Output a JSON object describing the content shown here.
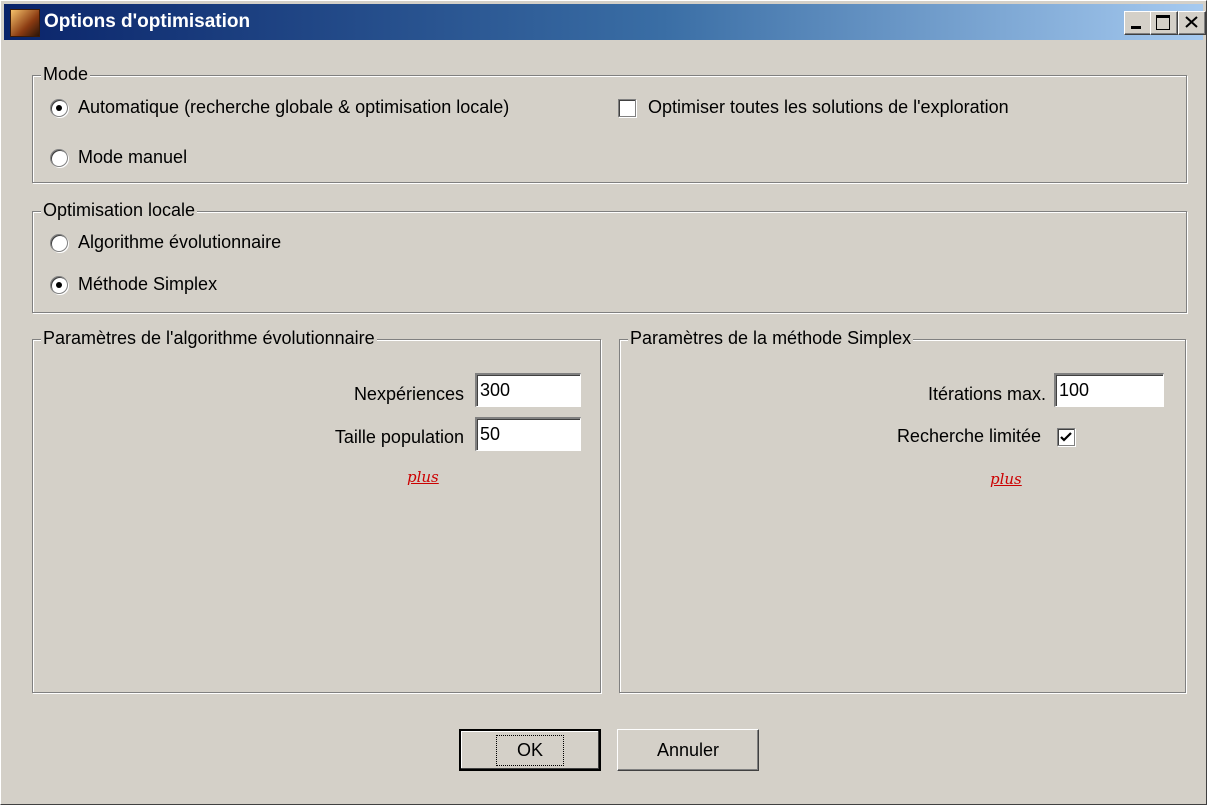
{
  "window": {
    "title": "Options d'optimisation"
  },
  "mode": {
    "legend": "Mode",
    "automatic_label": "Automatique (recherche globale & optimisation locale)",
    "automatic_selected": true,
    "manual_label": "Mode manuel",
    "manual_selected": false,
    "optimize_all_label": "Optimiser toutes les solutions de l'exploration",
    "optimize_all_checked": false
  },
  "local_optimisation": {
    "legend": "Optimisation locale",
    "evolutionary_label": "Algorithme évolutionnaire",
    "evolutionary_selected": false,
    "simplex_label": "Méthode Simplex",
    "simplex_selected": true
  },
  "evolutionary_params": {
    "legend": "Paramètres de l'algorithme évolutionnaire",
    "experiments_label": "Nexpériences",
    "experiments_value": "300",
    "population_label": "Taille population",
    "population_value": "50",
    "more_link": "plus"
  },
  "simplex_params": {
    "legend": "Paramètres de la méthode Simplex",
    "max_iterations_label": "Itérations max.",
    "max_iterations_value": "100",
    "limited_search_label": "Recherche limitée",
    "limited_search_checked": true,
    "more_link": "plus"
  },
  "buttons": {
    "ok": "OK",
    "cancel": "Annuler"
  }
}
